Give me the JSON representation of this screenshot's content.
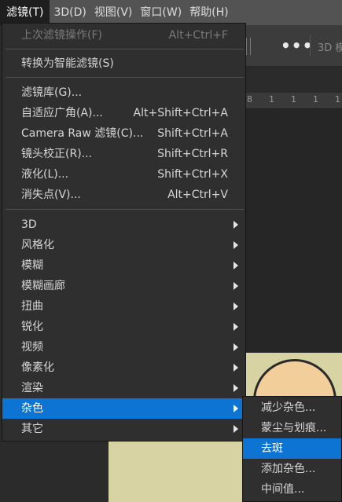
{
  "menubar": {
    "items": [
      {
        "label": "滤镜(T)",
        "active": true
      },
      {
        "label": "3D(D)",
        "active": false
      },
      {
        "label": "视图(V)",
        "active": false
      },
      {
        "label": "窗口(W)",
        "active": false
      },
      {
        "label": "帮助(H)",
        "active": false
      }
    ]
  },
  "toolbar": {
    "more_icon": "more-horizontal-icon",
    "mode_label": "3D 模"
  },
  "ruler": {
    "ticks": [
      "8",
      "1",
      "1",
      "1",
      "1"
    ]
  },
  "filter_menu": {
    "last_filter": {
      "label": "上次滤镜操作(F)",
      "shortcut": "Alt+Ctrl+F"
    },
    "convert_smart": {
      "label": "转换为智能滤镜(S)"
    },
    "filter_gallery": {
      "label": "滤镜库(G)..."
    },
    "adaptive_wide": {
      "label": "自适应广角(A)...",
      "shortcut": "Alt+Shift+Ctrl+A"
    },
    "camera_raw": {
      "label": "Camera Raw 滤镜(C)...",
      "shortcut": "Shift+Ctrl+A"
    },
    "lens_correction": {
      "label": "镜头校正(R)...",
      "shortcut": "Shift+Ctrl+R"
    },
    "liquify": {
      "label": "液化(L)...",
      "shortcut": "Shift+Ctrl+X"
    },
    "vanishing_point": {
      "label": "消失点(V)...",
      "shortcut": "Alt+Ctrl+V"
    },
    "submenus": [
      {
        "label": "3D"
      },
      {
        "label": "风格化"
      },
      {
        "label": "模糊"
      },
      {
        "label": "模糊画廊"
      },
      {
        "label": "扭曲"
      },
      {
        "label": "锐化"
      },
      {
        "label": "视频"
      },
      {
        "label": "像素化"
      },
      {
        "label": "渲染"
      },
      {
        "label": "杂色"
      },
      {
        "label": "其它"
      }
    ]
  },
  "noise_submenu": {
    "items": [
      {
        "label": "减少杂色..."
      },
      {
        "label": "蒙尘与划痕..."
      },
      {
        "label": "去斑"
      },
      {
        "label": "添加杂色..."
      },
      {
        "label": "中间值..."
      }
    ]
  },
  "colors": {
    "highlight": "#0d74d4",
    "menu_bg": "#2f2f2f",
    "menubar_bg": "#535353"
  }
}
